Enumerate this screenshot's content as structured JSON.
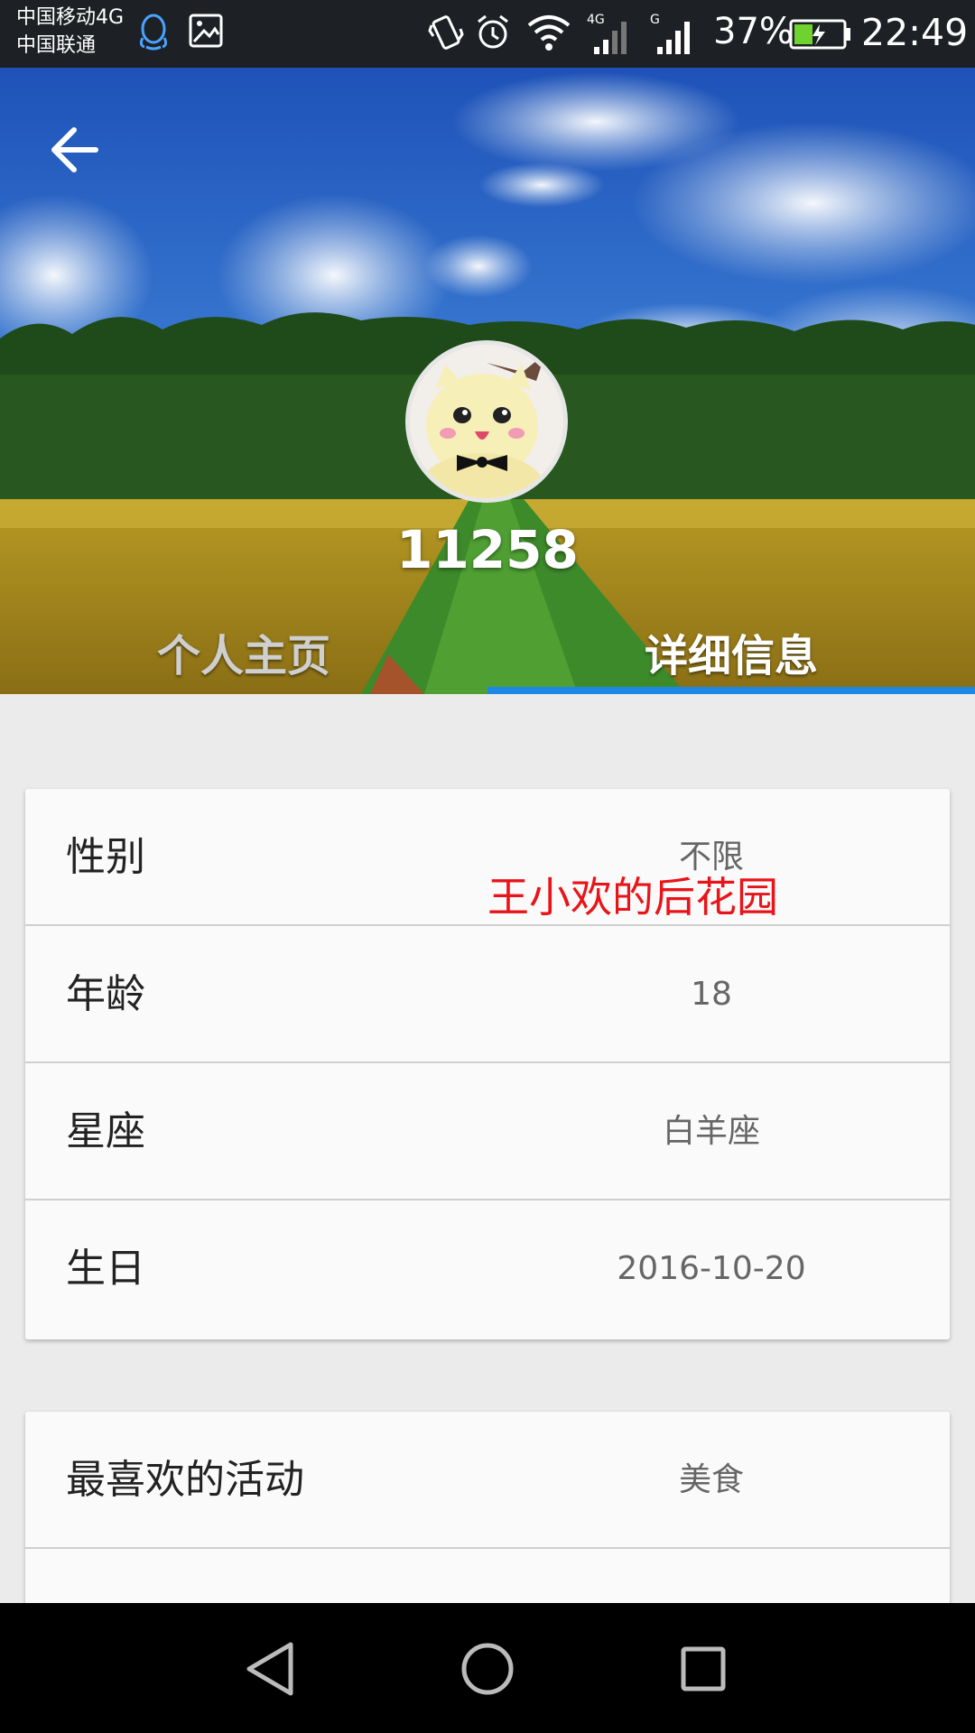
{
  "status_bar": {
    "carrier_1": "中国移动4G",
    "carrier_2": "中国联通",
    "network_1": "4G",
    "network_2": "G",
    "battery_percent": "37%",
    "time": "22:49",
    "icons": [
      "qq-icon",
      "gallery-icon",
      "vibrate-icon",
      "alarm-icon",
      "wifi-icon",
      "signal-icon",
      "signal-icon",
      "battery-charging-icon"
    ]
  },
  "header": {
    "back_icon": "arrow-left-icon",
    "username": "11258",
    "tabs": [
      {
        "label": "个人主页",
        "active": false
      },
      {
        "label": "详细信息",
        "active": true
      }
    ],
    "accent_color": "#1e88e5"
  },
  "details": {
    "basic_info": [
      {
        "label": "性别",
        "value": "不限"
      },
      {
        "label": "年龄",
        "value": "18"
      },
      {
        "label": "星座",
        "value": "白羊座"
      },
      {
        "label": "生日",
        "value": "2016-10-20"
      }
    ],
    "favorites": [
      {
        "label": "最喜欢的活动",
        "value": "美食"
      }
    ]
  },
  "watermark": "王小欢的后花园",
  "nav_bar": {
    "icons": [
      "nav-back-icon",
      "nav-home-icon",
      "nav-recents-icon"
    ]
  }
}
